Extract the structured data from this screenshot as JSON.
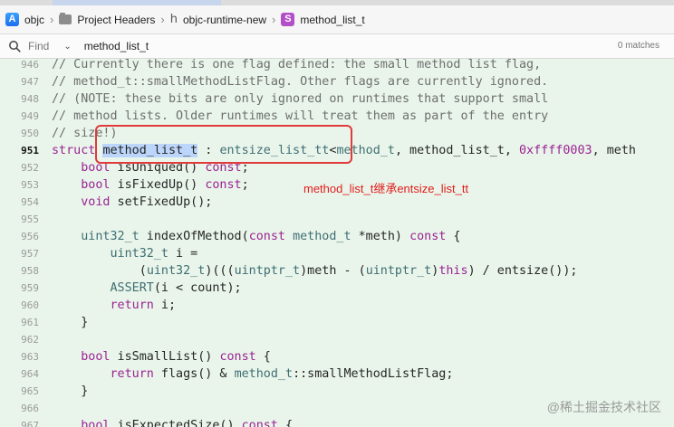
{
  "breadcrumbs": [
    {
      "label": "objc",
      "icon": "app-icon"
    },
    {
      "label": "Project Headers",
      "icon": "folder-icon"
    },
    {
      "label": "objc-runtime-new",
      "icon": "header-file-icon"
    },
    {
      "label": "method_list_t",
      "icon": "struct-symbol-icon"
    }
  ],
  "find": {
    "mode": "Find",
    "query": "method_list_t",
    "matches": "0 matches"
  },
  "editor": {
    "current_line": "951",
    "lines": [
      {
        "n": "946",
        "t": "// Currently there is one flag defined: the small method list flag,"
      },
      {
        "n": "947",
        "t": "// method_t::smallMethodListFlag. Other flags are currently ignored."
      },
      {
        "n": "948",
        "t": "// (NOTE: these bits are only ignored on runtimes that support small"
      },
      {
        "n": "949",
        "t": "// method lists. Older runtimes will treat them as part of the entry"
      },
      {
        "n": "950",
        "t": "// size!)"
      },
      {
        "n": "951",
        "t": "struct method_list_t : entsize_list_tt<method_t, method_list_t, 0xffff0003, meth"
      },
      {
        "n": "952",
        "t": "    bool isUniqued() const;"
      },
      {
        "n": "953",
        "t": "    bool isFixedUp() const;"
      },
      {
        "n": "954",
        "t": "    void setFixedUp();"
      },
      {
        "n": "955",
        "t": ""
      },
      {
        "n": "956",
        "t": "    uint32_t indexOfMethod(const method_t *meth) const {"
      },
      {
        "n": "957",
        "t": "        uint32_t i ="
      },
      {
        "n": "958",
        "t": "            (uint32_t)(((uintptr_t)meth - (uintptr_t)this) / entsize());"
      },
      {
        "n": "959",
        "t": "        ASSERT(i < count);"
      },
      {
        "n": "960",
        "t": "        return i;"
      },
      {
        "n": "961",
        "t": "    }"
      },
      {
        "n": "962",
        "t": ""
      },
      {
        "n": "963",
        "t": "    bool isSmallList() const {"
      },
      {
        "n": "964",
        "t": "        return flags() & method_t::smallMethodListFlag;"
      },
      {
        "n": "965",
        "t": "    }"
      },
      {
        "n": "966",
        "t": ""
      },
      {
        "n": "967",
        "t": "    bool isExpectedSize() const {"
      }
    ]
  },
  "annotation": {
    "text": "method_list_t继承entsize_list_tt",
    "color": "#e21d1d"
  },
  "watermark": "@稀土掘金技术社区",
  "colors": {
    "editor_bg": "#e9f5ea",
    "comment": "#6e6e6e",
    "keyword": "#9b2393",
    "type": "#3f6e74",
    "selection": "#bcd6fb",
    "annotation_box": "#e03a3a"
  }
}
